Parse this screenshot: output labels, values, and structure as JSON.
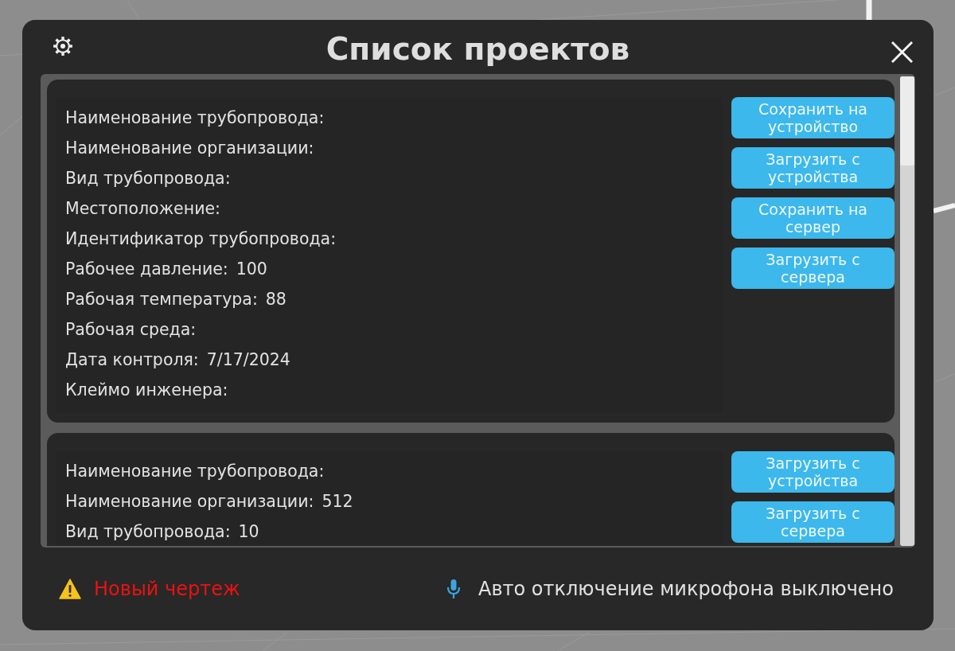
{
  "window": {
    "title": "Список проектов"
  },
  "projects": [
    {
      "fields": [
        {
          "label": "Наименование трубопровода:"
        },
        {
          "label": "Наименование организации:"
        },
        {
          "label": "Вид трубопровода:"
        },
        {
          "label": "Местоположение:"
        },
        {
          "label": "Идентификатор трубопровода:"
        },
        {
          "label": "Рабочее давление:",
          "value": "100"
        },
        {
          "label": "Рабочая температура:",
          "value": "88"
        },
        {
          "label": "Рабочая среда:"
        },
        {
          "label": "Дата контроля:",
          "value": "7/17/2024"
        },
        {
          "label": "Клеймо инженера:"
        }
      ],
      "buttons": [
        {
          "label": "Сохранить на устройство"
        },
        {
          "label": "Загрузить с устройства"
        },
        {
          "label": "Сохранить на сервер"
        },
        {
          "label": "Загрузить с сервера"
        }
      ]
    },
    {
      "fields": [
        {
          "label": "Наименование трубопровода:"
        },
        {
          "label": "Наименование организации:",
          "value": "512"
        },
        {
          "label": "Вид трубопровода:",
          "value": "10"
        }
      ],
      "buttons": [
        {
          "label": "Загрузить с устройства"
        },
        {
          "label": "Загрузить с сервера"
        }
      ]
    }
  ],
  "status_bar": {
    "warning": "Новый чертеж",
    "microphone_status": "Авто отключение микрофона выключено"
  }
}
